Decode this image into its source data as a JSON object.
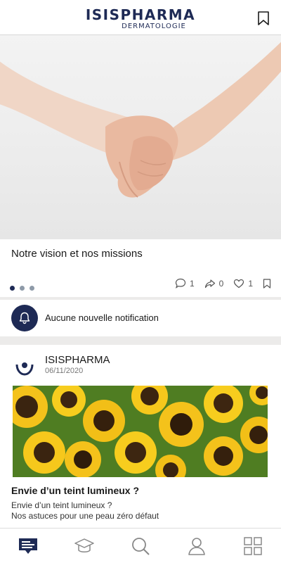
{
  "header": {
    "brand_name": "ISISPHARMA",
    "brand_sub": "DERMATOLOGIE",
    "bookmark_icon": "bookmark-icon"
  },
  "featured": {
    "image": "holding-hands-photo",
    "title": "Notre vision et nos missions",
    "pager_dots": 3,
    "active_dot": 0,
    "comments": "1",
    "shares": "0",
    "likes": "1"
  },
  "notification": {
    "icon": "bell-icon",
    "text": "Aucune nouvelle notification"
  },
  "post": {
    "author": "ISISPHARMA",
    "date": "06/11/2020",
    "image": "sunflowers-photo",
    "title": "Envie d’un teint lumineux ?",
    "desc_line1": "Envie d’un teint lumineux ?",
    "desc_line2": "Nos astuces pour une peau zéro défaut"
  },
  "bottom_nav": {
    "items": [
      "news-feed-icon",
      "graduation-cap-icon",
      "search-icon",
      "user-icon",
      "grid-icon"
    ],
    "active": "news-feed-icon"
  },
  "colors": {
    "brand_navy": "#1e2a55",
    "background": "#ecebea"
  }
}
